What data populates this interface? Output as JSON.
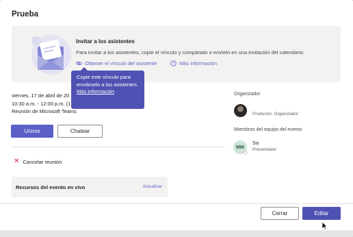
{
  "dialog": {
    "title": "Prueba"
  },
  "banner": {
    "heading": "Invitar a los asistentes",
    "text": "Para invitar a los asistentes, copie el vínculo y compártalo o envíelo en una invitación del calendario.",
    "link_copy": "Obtener el vínculo del asistente",
    "link_more": "Más información",
    "icons": {
      "link": "link-icon",
      "info": "info-icon",
      "illustration": "envelope-illustration"
    }
  },
  "tooltip": {
    "text": "Copie este vínculo para enviárselo a los asistentes.",
    "link": "Más información"
  },
  "event": {
    "date": "viernes, 17 de abril de 20",
    "time": "10:30 a.m. - 12:00 p.m. (1",
    "location": "Reunión de Microsoft Teams"
  },
  "actions": {
    "join": "Unirse",
    "chat": "Chatear"
  },
  "cancel_meeting": {
    "label": "Cancelar reunión",
    "icon": "close-icon"
  },
  "resources": {
    "title": "Recursos del evento en vivo",
    "update": "Actualizar"
  },
  "organizer": {
    "section_label": "Organizador",
    "role": "Productor, Organizador"
  },
  "team": {
    "section_label": "Miembros del equipo del evento",
    "initials": "MM",
    "name": "Sa",
    "role": "Presentador"
  },
  "footer": {
    "close": "Cerrar",
    "edit": "Editar"
  },
  "colors": {
    "accent": "#5b5fc7",
    "accent_dark": "#4f52b2",
    "danger": "#c4314b"
  }
}
